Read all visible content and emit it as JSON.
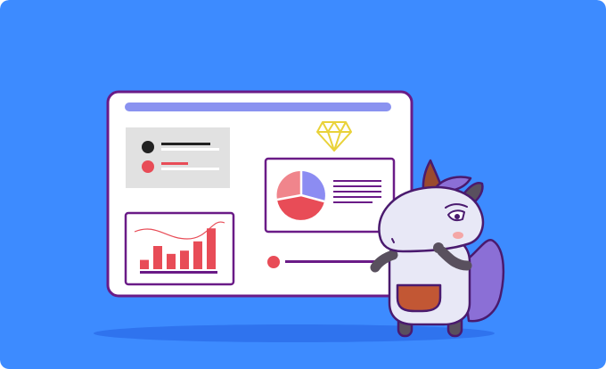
{
  "illustration": {
    "subject": "dashboard-with-unicorn-mascot",
    "icons": [
      "diamond-icon",
      "pie-chart-icon",
      "bar-chart-icon"
    ],
    "colors": {
      "background": "#3d8bff",
      "shadow": "#2f73ee",
      "board_fill": "#ffffff",
      "board_border": "#6a1b87",
      "top_bar": "#8a92f0",
      "panel_grey": "#e1e1e1",
      "dark_dot": "#222222",
      "accent_red": "#e84c57",
      "pie_pink": "#f0858c",
      "pie_lilac": "#8c8cf2",
      "diamond": "#e9d23a",
      "unicorn_body": "#e8e8f6",
      "unicorn_mane": "#8b6fd6",
      "unicorn_horn": "#9a4a2e",
      "unicorn_cheek": "#f4a6a6",
      "apron_pocket": "#c25734",
      "limbs": "#59505e"
    },
    "bar_chart": {
      "values": [
        0.2,
        0.5,
        0.33,
        0.4,
        0.6,
        0.88
      ]
    }
  }
}
